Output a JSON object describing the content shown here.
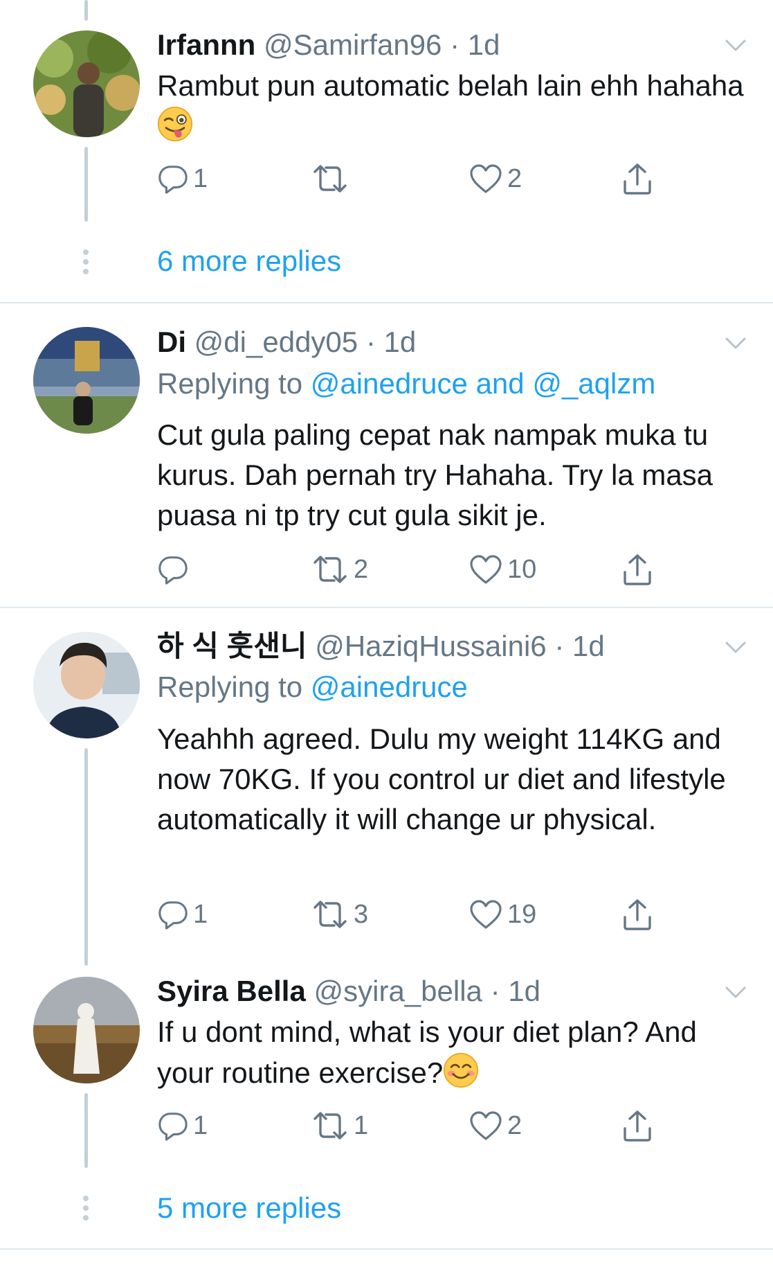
{
  "tweets": [
    {
      "name": "Irfannn",
      "handle": "@Samirfan96",
      "sep": "·",
      "time": "1d",
      "text": "Rambut pun automatic belah lain ehh hahaha",
      "emoji": "winking-face-with-tongue",
      "replies": "1",
      "retweets": "",
      "likes": "2",
      "avatar_colors": [
        "#4c6b2f",
        "#c9a95c",
        "#3d3a34"
      ]
    },
    {
      "name": "Di",
      "handle": "@di_eddy05",
      "sep": "·",
      "time": "1d",
      "replying_prefix": "Replying to",
      "replying_mentions": "@ainedruce and @_aqlzm",
      "text": "Cut gula paling cepat nak nampak muka tu kurus. Dah pernah try Hahaha. Try la masa puasa ni tp try cut gula sikit je.",
      "replies": "",
      "retweets": "2",
      "likes": "10",
      "avatar_colors": [
        "#2f4a7a",
        "#6e8a4a",
        "#1a1a1a"
      ]
    },
    {
      "name": "하 식 훗샌니",
      "handle": "@HaziqHussaini6",
      "sep": "·",
      "time": "1d",
      "replying_prefix": "Replying to",
      "replying_mentions": "@ainedruce",
      "text": "Yeahhh agreed. Dulu my weight 114KG and now 70KG. If you control ur diet and lifestyle automatically it will change ur physical.",
      "replies": "1",
      "retweets": "3",
      "likes": "19",
      "avatar_colors": [
        "#e8eef2",
        "#1f2d44",
        "#2a2420"
      ]
    },
    {
      "name": "Syira Bella",
      "handle": "@syira_bella",
      "sep": "·",
      "time": "1d",
      "text": "If u dont mind, what is your diet plan? And your routine exercise?",
      "emoji": "smiling-face-with-smiling-eyes",
      "replies": "1",
      "retweets": "1",
      "likes": "2",
      "avatar_colors": [
        "#a8aeb3",
        "#8a6a3a",
        "#f2efe8"
      ]
    }
  ],
  "more_replies": [
    "6 more replies",
    "5 more replies"
  ],
  "colors": {
    "link": "#1da1f2",
    "secondary": "#657786",
    "line": "#c4cfd6",
    "divider": "#e1e8ed"
  },
  "icons": [
    "reply-icon",
    "retweet-icon",
    "like-icon",
    "share-icon",
    "chevron-down-icon"
  ]
}
